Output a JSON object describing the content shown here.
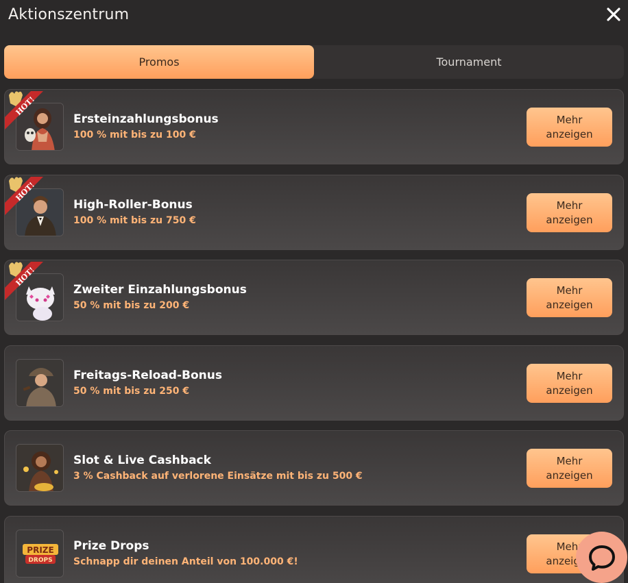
{
  "header": {
    "title": "Aktionszentrum",
    "close_icon": "close-icon"
  },
  "tabs": [
    {
      "label": "Promos",
      "active": true
    },
    {
      "label": "Tournament",
      "active": false
    }
  ],
  "promos": [
    {
      "title": "Ersteinzahlungsbonus",
      "subtitle": "100 % mit bis zu 100 €",
      "hot": true,
      "hot_label": "HOT!",
      "button_line1": "Mehr",
      "button_line2": "anzeigen",
      "image": "woman-with-owl"
    },
    {
      "title": "High-Roller-Bonus",
      "subtitle": "100 % mit bis zu 750 €",
      "hot": true,
      "hot_label": "HOT!",
      "button_line1": "Mehr",
      "button_line2": "anzeigen",
      "image": "man-in-suit"
    },
    {
      "title": "Zweiter Einzahlungsbonus",
      "subtitle": "50 % mit bis zu 200 €",
      "hot": true,
      "hot_label": "HOT!",
      "button_line1": "Mehr",
      "button_line2": "anzeigen",
      "image": "white-cat"
    },
    {
      "title": "Freitags-Reload-Bonus",
      "subtitle": "50 % mit bis zu 250 €",
      "hot": false,
      "button_line1": "Mehr",
      "button_line2": "anzeigen",
      "image": "detective"
    },
    {
      "title": "Slot & Live Cashback",
      "subtitle": "3 % Cashback auf verlorene Einsätze mit bis zu 500 €",
      "hot": false,
      "button_line1": "Mehr",
      "button_line2": "anzeigen",
      "image": "woman-with-gold"
    },
    {
      "title": "Prize Drops",
      "subtitle": "Schnapp dir deinen Anteil von 100.000 €!",
      "hot": false,
      "button_line1": "Mehr",
      "button_line2": "anzeigen",
      "image": "prize-drops-logo",
      "image_text_1": "PRIZE",
      "image_text_2": "DROPS"
    }
  ],
  "chat": {
    "icon": "chat-icon"
  },
  "colors": {
    "accent": "#ff9f5c",
    "accent_light": "#ffc58e",
    "subtitle": "#ffb477",
    "background": "#2b2929",
    "hot_ribbon": "#c62a2a"
  }
}
